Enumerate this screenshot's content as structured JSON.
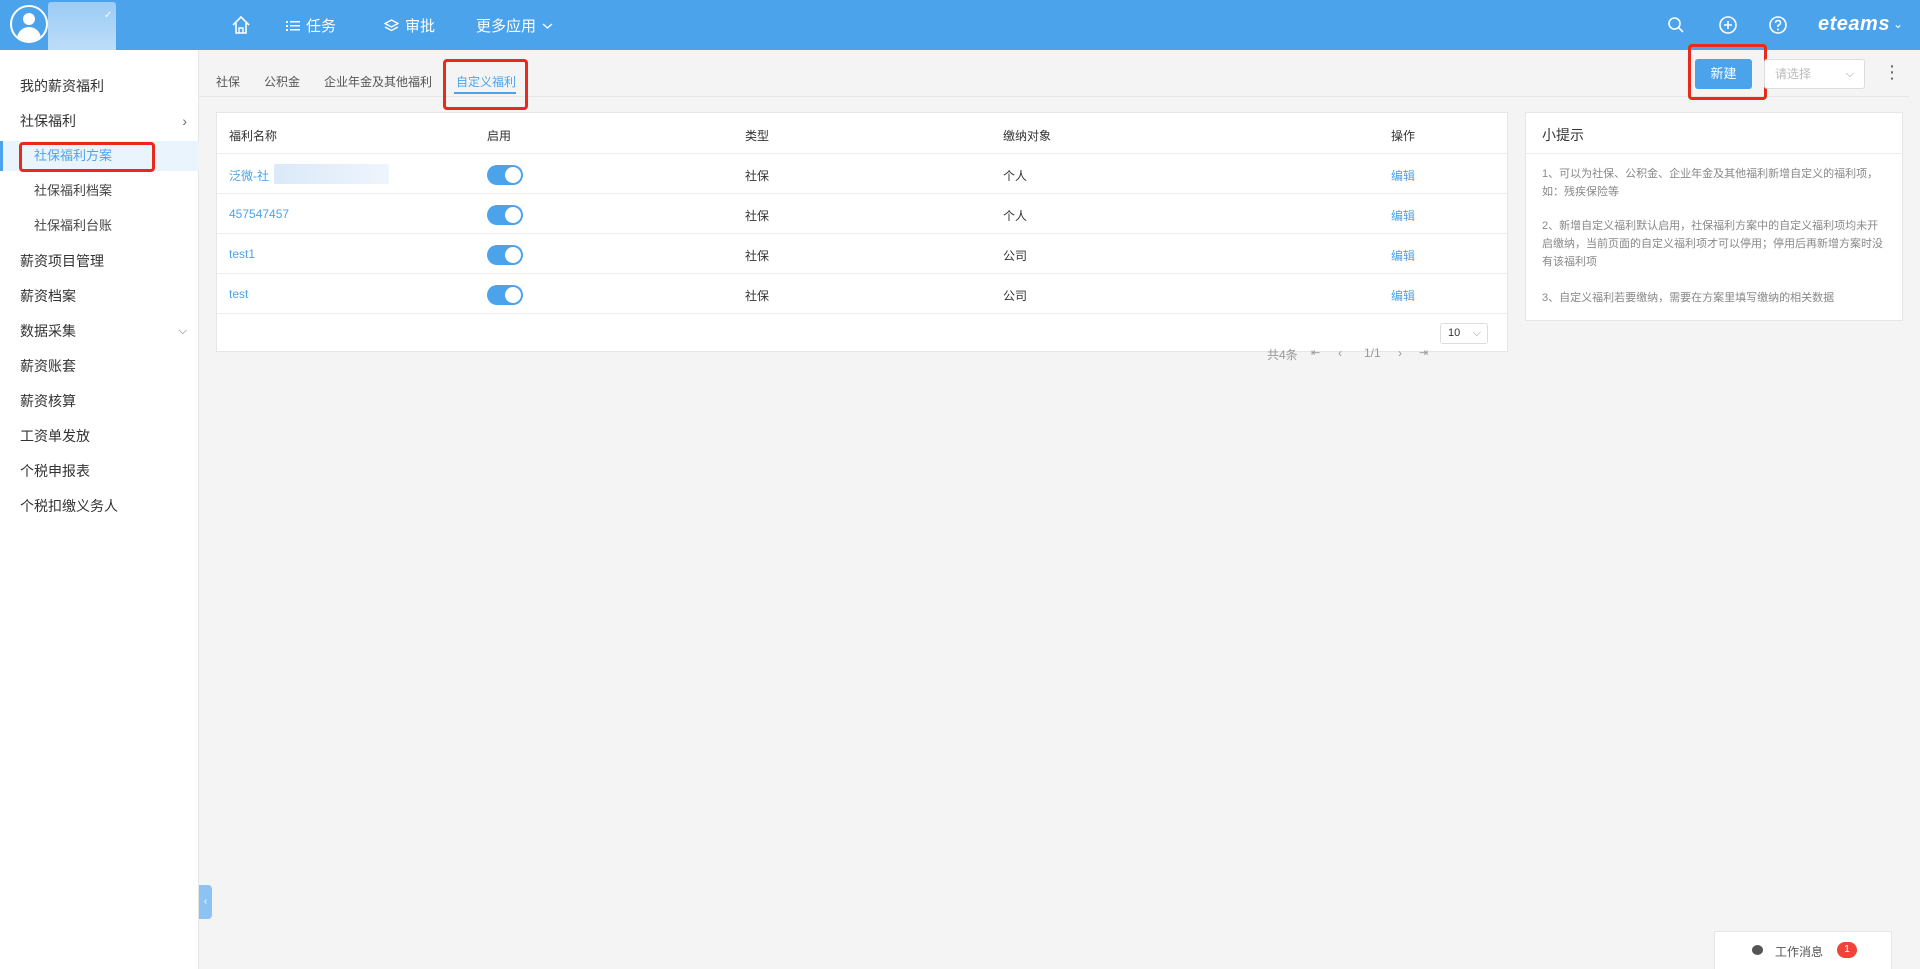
{
  "topbar": {
    "nav": {
      "task": "任务",
      "approve": "审批",
      "more": "更多应用"
    },
    "brand": "eteams"
  },
  "sidebar": {
    "items": [
      {
        "label": "我的薪资福利"
      },
      {
        "label": "社保福利"
      },
      {
        "label": "社保福利方案"
      },
      {
        "label": "社保福利档案"
      },
      {
        "label": "社保福利台账"
      },
      {
        "label": "薪资项目管理"
      },
      {
        "label": "薪资档案"
      },
      {
        "label": "数据采集"
      },
      {
        "label": "薪资账套"
      },
      {
        "label": "薪资核算"
      },
      {
        "label": "工资单发放"
      },
      {
        "label": "个税申报表"
      },
      {
        "label": "个税扣缴义务人"
      }
    ]
  },
  "tabs": [
    "社保",
    "公积金",
    "企业年金及其他福利",
    "自定义福利"
  ],
  "toolbar": {
    "new_label": "新建",
    "select_placeholder": "请选择"
  },
  "table": {
    "headers": [
      "福利名称",
      "启用",
      "类型",
      "缴纳对象",
      "操作"
    ],
    "rows": [
      {
        "name": "泛微-社",
        "type": "社保",
        "target": "个人",
        "action": "编辑"
      },
      {
        "name": "457547457",
        "type": "社保",
        "target": "个人",
        "action": "编辑"
      },
      {
        "name": "test1",
        "type": "社保",
        "target": "公司",
        "action": "编辑"
      },
      {
        "name": "test",
        "type": "社保",
        "target": "公司",
        "action": "编辑"
      }
    ],
    "pagination": {
      "total": "共4条",
      "page": "1/1",
      "size": "10"
    }
  },
  "tips": {
    "title": "小提示",
    "items": [
      "1、可以为社保、公积金、企业年金及其他福利新增自定义的福利项，如：残疾保险等",
      "2、新增自定义福利默认启用，社保福利方案中的自定义福利项均未开启缴纳，当前页面的自定义福利项才可以停用；停用后再新增方案时没有该福利项",
      "3、自定义福利若要缴纳，需要在方案里填写缴纳的相关数据"
    ]
  },
  "message": {
    "label": "工作消息",
    "count": "1"
  },
  "colors": {
    "primary": "#4ba3ec",
    "highlight": "#e8291c"
  }
}
